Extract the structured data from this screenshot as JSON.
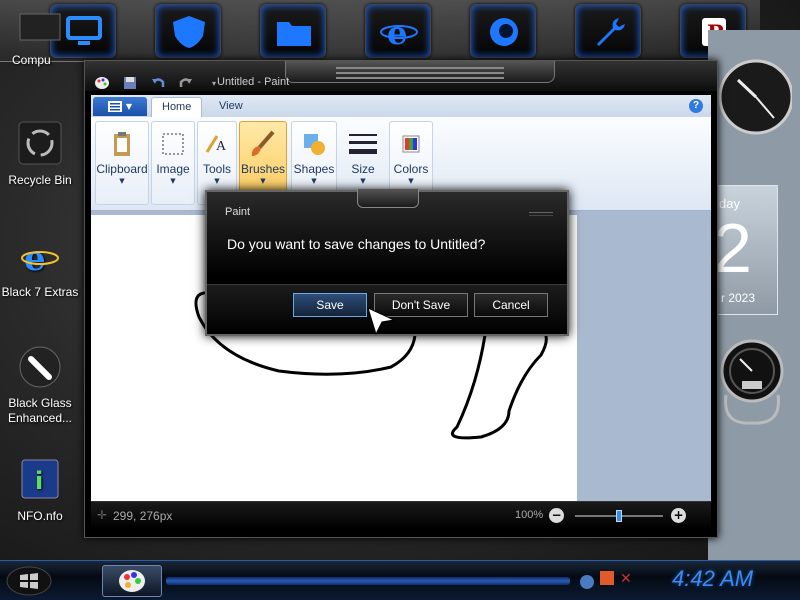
{
  "desktop": {
    "icons": [
      {
        "label": "Compu"
      },
      {
        "label": "Recycle Bin"
      },
      {
        "label": "Black 7 Extras"
      },
      {
        "label": "Black Glass Enhanced..."
      },
      {
        "label": "NFO.nfo"
      }
    ]
  },
  "dock": {
    "items": [
      "computer",
      "shield",
      "documents",
      "internet",
      "firefox",
      "settings",
      "rocket"
    ]
  },
  "gadgets": {
    "calendar_day": "day",
    "calendar_date": "2",
    "calendar_year": "r 2023"
  },
  "paint": {
    "window_title": "Untitled - Paint",
    "tabs": [
      "Home",
      "View"
    ],
    "ribbon_groups": [
      "Clipboard",
      "Image",
      "Tools",
      "Brushes",
      "Shapes",
      "Size",
      "Colors"
    ],
    "status": {
      "coordinates": "299, 276px",
      "zoom": "100%",
      "zoom_fraction": 0.5
    }
  },
  "dialog": {
    "title": "Paint",
    "message": "Do you want to save changes to Untitled?",
    "save_label": "Save",
    "dont_save_label": "Don't Save",
    "cancel_label": "Cancel"
  },
  "taskbar": {
    "clock": "4:42 AM"
  },
  "colors": {
    "accent_blue": "#3c8cf0",
    "brushes_highlight": "#fbc95a"
  }
}
